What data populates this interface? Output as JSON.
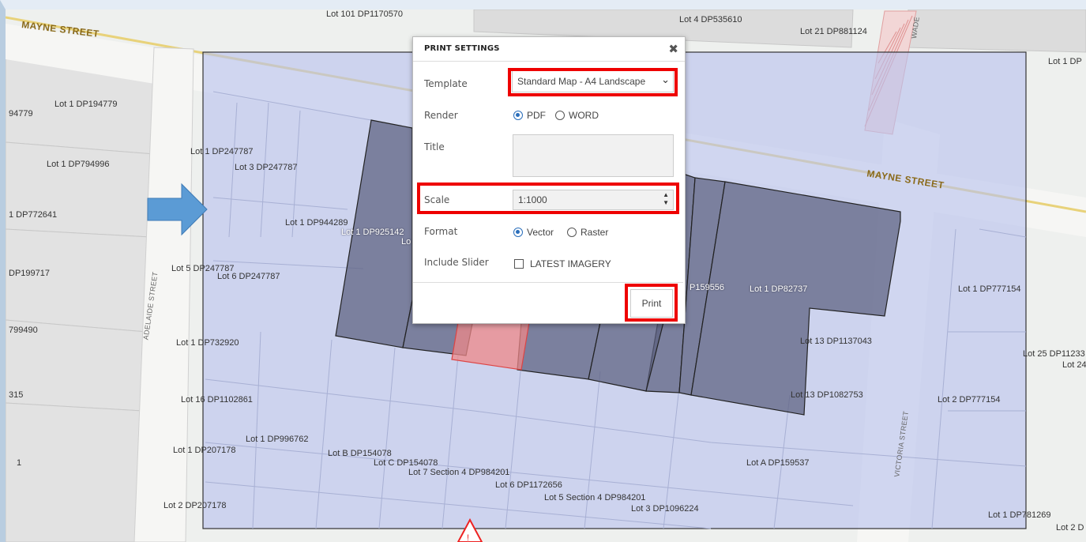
{
  "dialog": {
    "title": "PRINT SETTINGS",
    "close_icon": "close-icon",
    "template_label": "Template",
    "template_value": "Standard Map - A4 Landscape",
    "render_label": "Render",
    "render_options": [
      "PDF",
      "WORD"
    ],
    "render_selected": "PDF",
    "title_label": "Title",
    "title_value": "",
    "scale_label": "Scale",
    "scale_value": "1:1000",
    "format_label": "Format",
    "format_options": [
      "Vector",
      "Raster"
    ],
    "format_selected": "Vector",
    "slider_label": "Include Slider",
    "slider_option": "LATEST IMAGERY",
    "slider_checked": false,
    "print_label": "Print"
  },
  "annotation": {
    "highlight_color": "#e00000",
    "arrow_color": "#5b9bd5"
  },
  "map": {
    "streets": {
      "mayne_left": "MAYNE STREET",
      "mayne_right": "MAYNE STREET",
      "adelaide": "ADELAIDE STREET",
      "victoria": "VICTORIA STREET",
      "wade": "WADE"
    },
    "lots": {
      "l01": "Lot 101 DP1170570",
      "l02": "Lot 4 DP535610",
      "l03": "Lot 21 DP881124",
      "l04": "Lot 1 DP",
      "l05": "Lot 1 DP194779",
      "l06": "94779",
      "l07": "Lot 1 DP247787",
      "l08": "Lot 1 DP794996",
      "l09": "Lot 3 DP247787",
      "l10": "1 DP772641",
      "l11": "Lot 1 DP944289",
      "l12": "Lot 1 DP925142",
      "l13": "DP199717",
      "l14": "Lot 5 DP247787",
      "l15": "Lot 6 DP247787",
      "l16": "P159556",
      "l17": "Lot 1 DP82737",
      "l18": "Lot 1 DP777154",
      "l19": "799490",
      "l20": "Lot 1 DP732920",
      "l21": "Lot 13 DP1137043",
      "l22": "Lot 25 DP11233",
      "l23": "Lot 24",
      "l24": "315",
      "l25": "Lot 16 DP1102861",
      "l26": "Lot 13 DP1082753",
      "l27": "Lot 2 DP777154",
      "l28": "Lot 1 DP996762",
      "l29": "Lot 1 DP207178",
      "l30": "Lot B DP154078",
      "l31": "Lot C DP154078",
      "l32": "Lot 7 Section 4 DP984201",
      "l33": "Lot A DP159537",
      "l34": "1",
      "l35": "Lot 6 DP1172656",
      "l36": "Lot 5 Section 4 DP984201",
      "l37": "Lot 3 DP1096224",
      "l38": "Lot 2 DP207178",
      "l39": "Lot 1 DP781269",
      "l40": "Lot 2 D",
      "l41": "Lo"
    }
  }
}
